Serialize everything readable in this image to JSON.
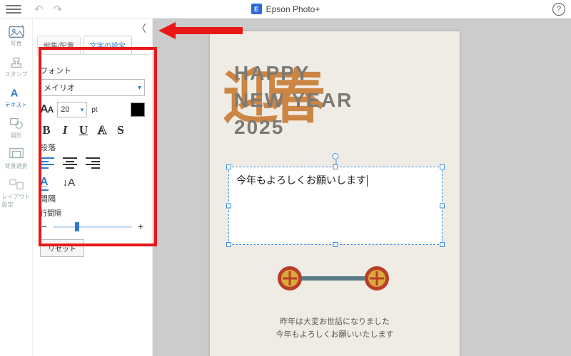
{
  "titlebar": {
    "app_name": "Epson Photo+"
  },
  "rail": {
    "photo": "写真",
    "stamp": "スタンプ",
    "text": "テキスト",
    "shape": "図形",
    "bg": "背景選択",
    "layout": "レイアウト設定"
  },
  "panel": {
    "tab_edit": "編集/配置",
    "tab_text": "文字の設定",
    "font_label": "フォント",
    "font_value": "メイリオ",
    "size_value": "20",
    "pt_label": "pt",
    "para_label": "段落",
    "spacing_label": "間隔",
    "line_spacing_label": "行間隔",
    "reset_label": "リセット"
  },
  "canvas": {
    "hny_l1": "HAPPY",
    "hny_l2": "NEW YEAR",
    "hny_l3": "2025",
    "brush": "迎春",
    "textbox_value": "今年もよろしくお願いします",
    "greet_l1": "昨年は大変お世話になりました",
    "greet_l2": "今年もよろしくお願いいたします"
  }
}
